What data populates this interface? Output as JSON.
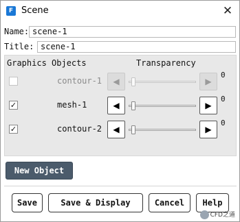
{
  "window": {
    "title": "Scene",
    "app_icon_letter": "F"
  },
  "form": {
    "name_label": "Name:",
    "name_value": "scene-1",
    "title_label": "Title:",
    "title_value": "scene-1"
  },
  "objects": {
    "graphics_header": "Graphics Objects",
    "transparency_header": "Transparency",
    "rows": [
      {
        "checked": false,
        "enabled": false,
        "name": "contour-1",
        "transparency": 0,
        "value_label": "0",
        "left_arrow": "◀",
        "right_arrow": "▶"
      },
      {
        "checked": true,
        "enabled": true,
        "name": "mesh-1",
        "transparency": 0,
        "value_label": "0",
        "left_arrow": "◀",
        "right_arrow": "▶"
      },
      {
        "checked": true,
        "enabled": true,
        "name": "contour-2",
        "transparency": 0,
        "value_label": "0",
        "left_arrow": "◀",
        "right_arrow": "▶"
      }
    ]
  },
  "new_object_label": "New Object",
  "footer": {
    "save_label": "Save",
    "save_display_label": "Save & Display",
    "cancel_label": "Cancel",
    "help_label": "Help"
  },
  "watermark": {
    "text": "CFD之道"
  },
  "colors": {
    "accent": "#1a78d6",
    "new_object_bg": "#4b5b6b",
    "panel_bg": "#e8e8e8"
  }
}
